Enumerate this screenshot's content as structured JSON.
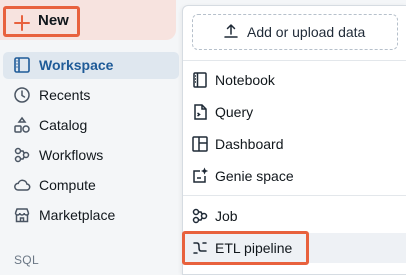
{
  "sidebar": {
    "new_button": {
      "label": "New",
      "icon": "plus-icon"
    },
    "items": [
      {
        "label": "Workspace",
        "icon": "workspace-icon",
        "active": true
      },
      {
        "label": "Recents",
        "icon": "clock-icon"
      },
      {
        "label": "Catalog",
        "icon": "catalog-icon"
      },
      {
        "label": "Workflows",
        "icon": "workflows-icon"
      },
      {
        "label": "Compute",
        "icon": "cloud-icon"
      },
      {
        "label": "Marketplace",
        "icon": "store-icon"
      }
    ],
    "section_label": "SQL"
  },
  "menu": {
    "upload_label": "Add or upload data",
    "items": [
      {
        "label": "Notebook",
        "icon": "notebook-icon"
      },
      {
        "label": "Query",
        "icon": "query-icon"
      },
      {
        "label": "Dashboard",
        "icon": "dashboard-icon"
      },
      {
        "label": "Genie space",
        "icon": "genie-icon"
      },
      {
        "label": "Job",
        "icon": "job-icon"
      },
      {
        "label": "ETL pipeline",
        "icon": "pipeline-icon",
        "highlighted": true
      }
    ]
  },
  "colors": {
    "accent": "#e8613d",
    "active_nav": "#1f5b98"
  }
}
